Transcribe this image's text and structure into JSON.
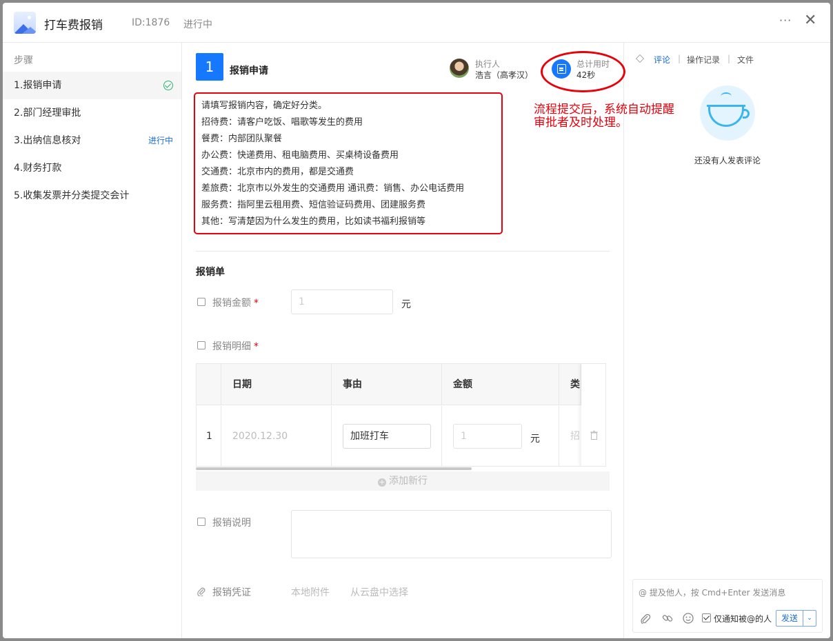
{
  "header": {
    "title": "打车费报销",
    "id": "ID:1876",
    "status": "进行中",
    "more": "···",
    "close": "✕"
  },
  "sidebar": {
    "title": "步骤",
    "steps": [
      {
        "label": "1.报销申请",
        "badge": ""
      },
      {
        "label": "2.部门经理审批",
        "badge": ""
      },
      {
        "label": "3.出纳信息核对",
        "badge": "进行中"
      },
      {
        "label": "4.财务打款",
        "badge": ""
      },
      {
        "label": "5.收集发票并分类提交会计",
        "badge": ""
      }
    ]
  },
  "main": {
    "step_number": "1",
    "step_name": "报销申请",
    "executor": {
      "label": "执行人",
      "name": "浩言（高孝汉）"
    },
    "time": {
      "label": "总计用时",
      "value": "42秒"
    },
    "description": [
      "请填写报销内容，确定好分类。",
      "招待费：请客户吃饭、唱歌等发生的费用",
      "餐费：内部团队聚餐",
      "办公费：快递费用、租电脑费用、买桌椅设备费用",
      "交通费：北京市内的费用，都是交通费",
      "差旅费：北京市以外发生的交通费用  通讯费：销售、办公电话费用",
      "服务费：指阿里云租用费、短信验证码费用、团建服务费",
      "其他：写清楚因为什么发生的费用，比如读书福利报销等"
    ],
    "form_title": "报销单",
    "amount": {
      "label": "报销金额",
      "required": "*",
      "value": "1",
      "unit": "元"
    },
    "detail": {
      "label": "报销明细",
      "required": "*",
      "columns": [
        "日期",
        "事由",
        "金额",
        "类"
      ],
      "rows": [
        {
          "index": "1",
          "date": "2020.12.30",
          "reason": "加班打车",
          "amount": "1",
          "unit": "元",
          "type": "招"
        }
      ],
      "add_row": "添加新行"
    },
    "note": {
      "label": "报销说明",
      "value": ""
    },
    "voucher": {
      "label": "报销凭证",
      "local": "本地附件",
      "cloud": "从云盘中选择"
    }
  },
  "annotation": {
    "line1": "流程提交后，系统自动提醒",
    "line2": "审批者及时处理。"
  },
  "right": {
    "tabs": [
      "评论",
      "操作记录",
      "文件"
    ],
    "separator": "|",
    "empty_text": "还没有人发表评论",
    "comment_placeholder": "@ 提及他人，按 Cmd+Enter 发送消息",
    "notify_label": "仅通知被@的人",
    "send_label": "发送",
    "send_dropdown": "⌄"
  }
}
